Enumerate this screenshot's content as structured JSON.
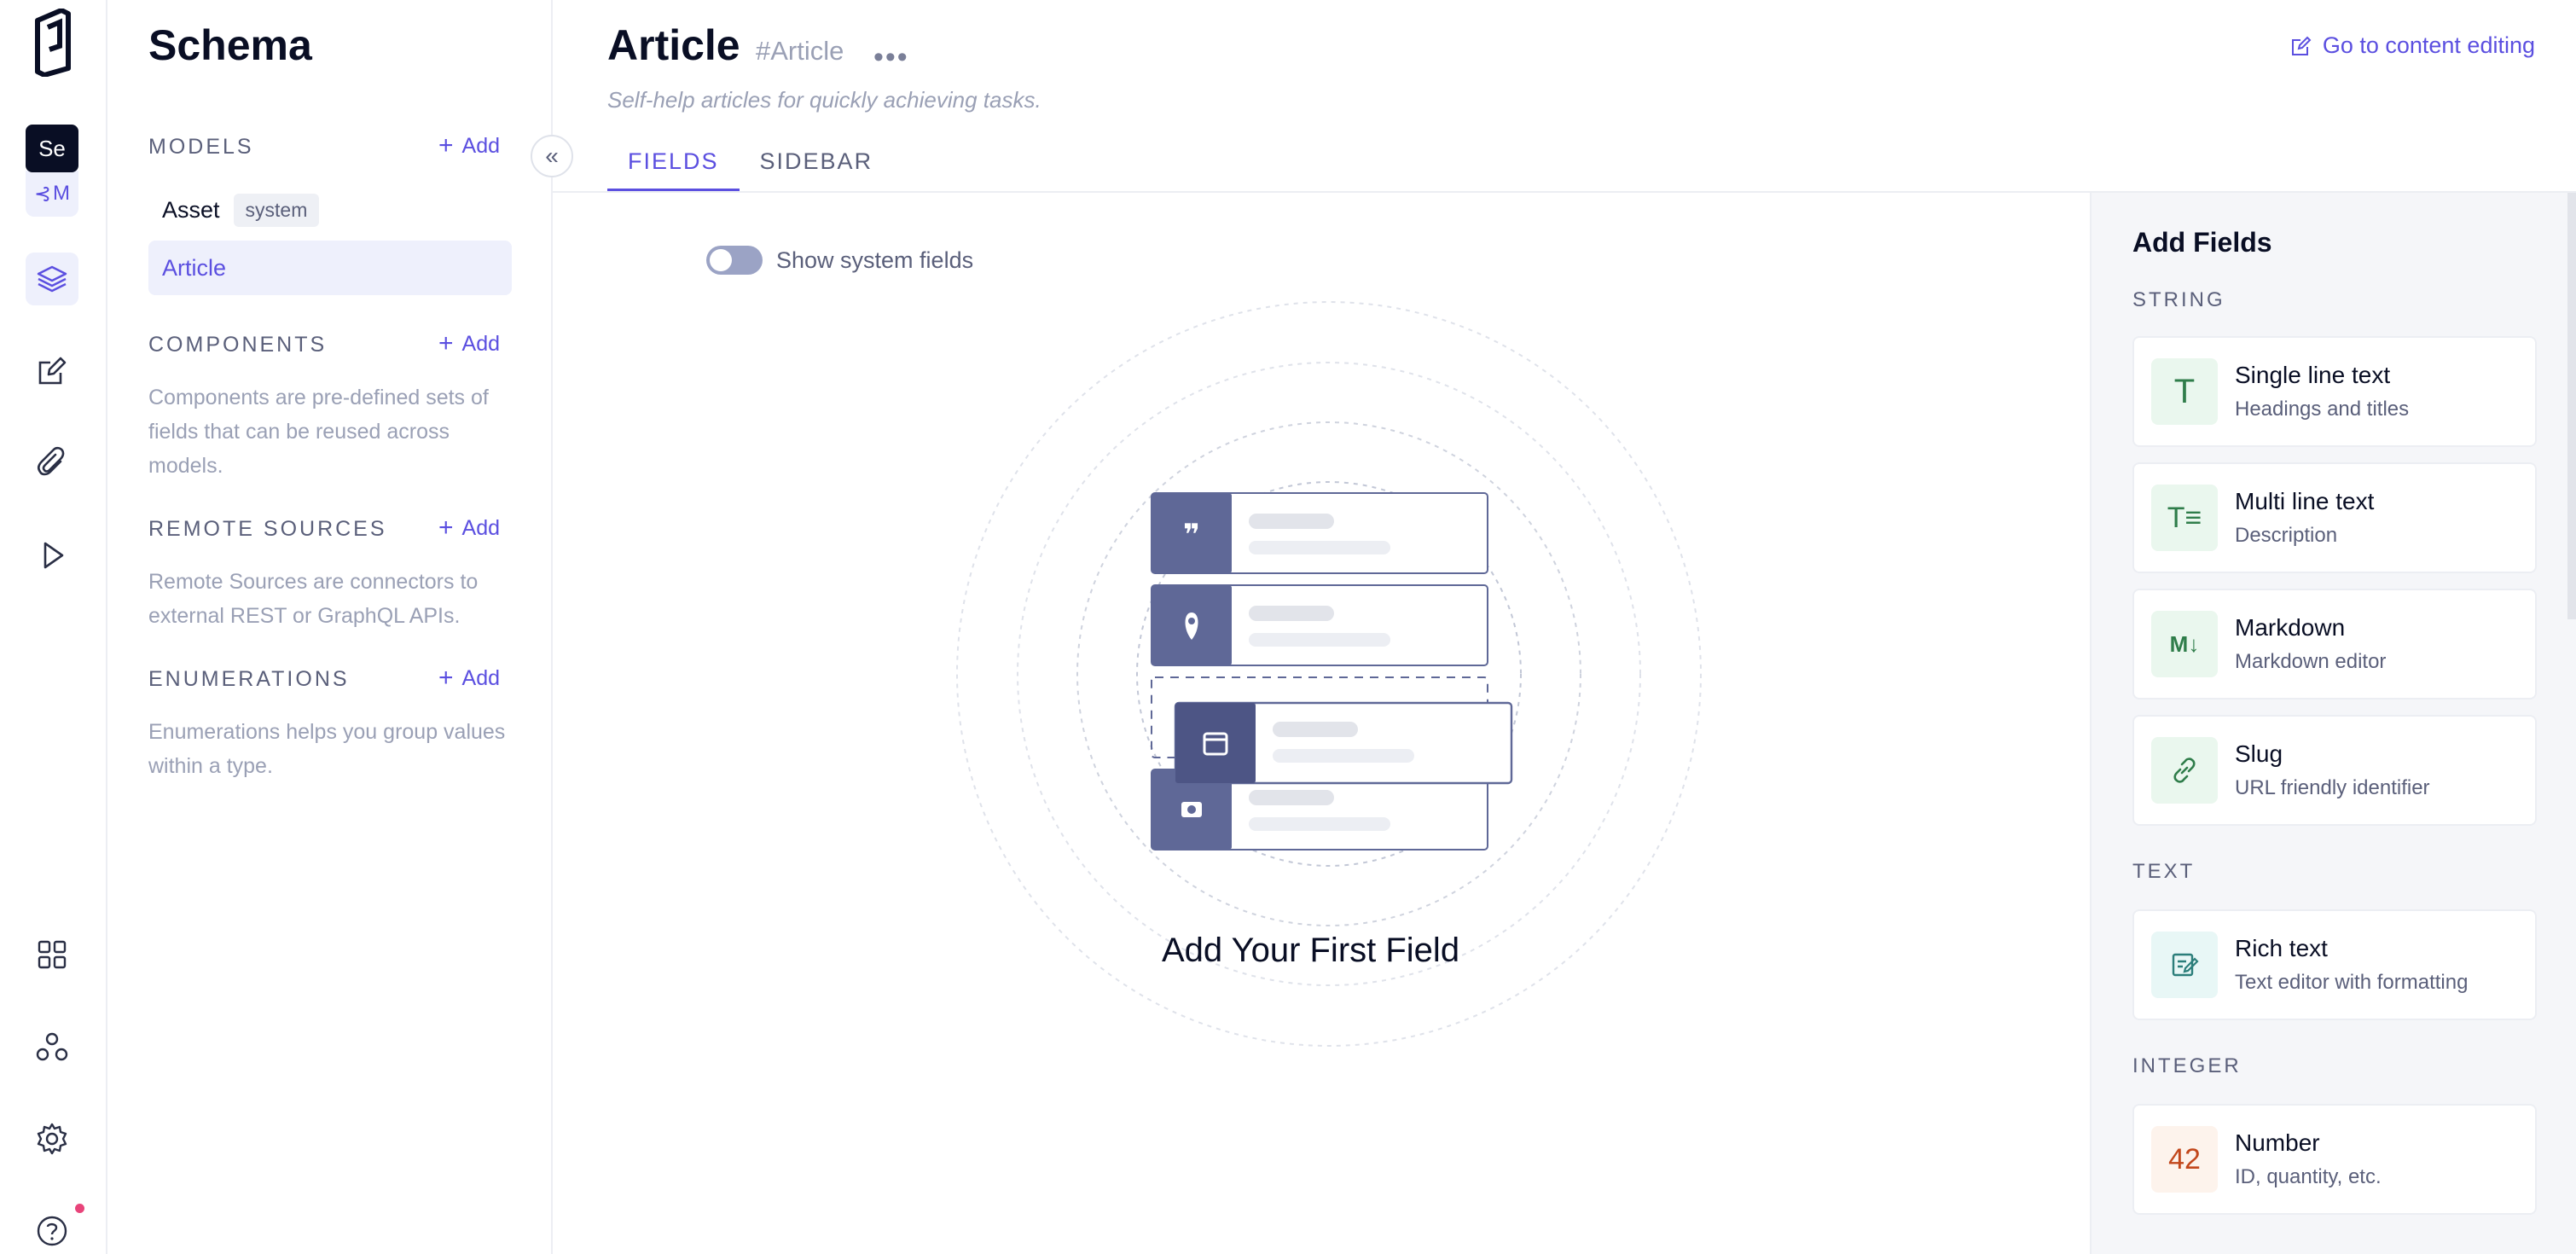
{
  "rail": {
    "tooltip": "Se",
    "schema_letter": "M",
    "icons": [
      "logo-icon",
      "schema-icon",
      "layers-icon",
      "edit-icon",
      "paperclip-icon",
      "play-icon",
      "apps-icon",
      "webhooks-icon",
      "settings-icon",
      "help-icon"
    ]
  },
  "sidebar": {
    "title": "Schema",
    "models": {
      "heading": "MODELS",
      "add": "Add",
      "items": [
        {
          "label": "Asset",
          "badge": "system"
        },
        {
          "label": "Article"
        }
      ]
    },
    "components": {
      "heading": "COMPONENTS",
      "add": "Add",
      "desc": "Components are pre-defined sets of fields that can be reused across models."
    },
    "remote": {
      "heading": "REMOTE SOURCES",
      "add": "Add",
      "desc": "Remote Sources are connectors to external REST or GraphQL APIs."
    },
    "enums": {
      "heading": "ENUMERATIONS",
      "add": "Add",
      "desc": "Enumerations helps you group values within a type."
    }
  },
  "header": {
    "title": "Article",
    "api_id": "#Article",
    "more": "•••",
    "subtitle": "Self-help articles for quickly achieving tasks.",
    "go_edit": "Go to content editing",
    "tabs": [
      "FIELDS",
      "SIDEBAR"
    ]
  },
  "main": {
    "toggle_label": "Show system fields",
    "empty_title": "Add Your First Field"
  },
  "panel": {
    "title": "Add Fields",
    "sections": {
      "string": "STRING",
      "text": "TEXT",
      "integer": "INTEGER"
    },
    "cards": [
      {
        "title": "Single line text",
        "sub": "Headings and titles",
        "glyph": "T",
        "icon": "text-icon"
      },
      {
        "title": "Multi line text",
        "sub": "Description",
        "glyph": "T≡",
        "icon": "multiline-icon"
      },
      {
        "title": "Markdown",
        "sub": "Markdown editor",
        "glyph": "M↓",
        "icon": "markdown-icon"
      },
      {
        "title": "Slug",
        "sub": "URL friendly identifier",
        "glyph": "",
        "icon": "link-icon"
      },
      {
        "title": "Rich text",
        "sub": "Text editor with formatting",
        "glyph": "",
        "icon": "richtext-icon"
      },
      {
        "title": "Number",
        "sub": "ID, quantity, etc.",
        "glyph": "42",
        "icon": "number-icon"
      }
    ]
  },
  "colors": {
    "accent": "#5b4fe0",
    "dark": "#090e24",
    "illus": "#5f6897",
    "green_bg": "#eaf7ee",
    "green": "#2f7d4a",
    "orange": "#c2471b",
    "orange_bg": "#fdf3ec"
  }
}
